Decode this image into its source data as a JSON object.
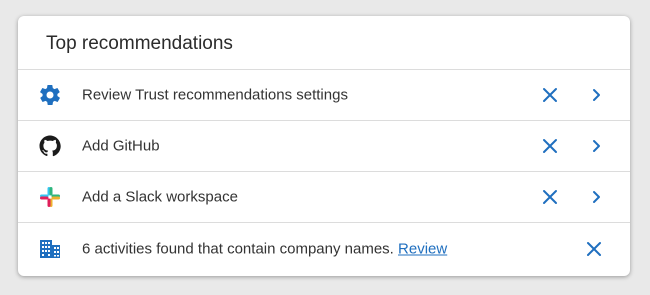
{
  "card": {
    "title": "Top recommendations"
  },
  "rows": [
    {
      "icon": "gear-icon",
      "label": "Review Trust recommendations settings",
      "actions": [
        "dismiss",
        "open"
      ]
    },
    {
      "icon": "github-icon",
      "label": "Add GitHub",
      "actions": [
        "dismiss",
        "open"
      ]
    },
    {
      "icon": "slack-icon",
      "label": "Add a Slack workspace",
      "actions": [
        "dismiss",
        "open"
      ]
    },
    {
      "icon": "building-icon",
      "label": "6 activities found that contain company names.",
      "link": "Review",
      "actions": [
        "dismiss"
      ]
    }
  ],
  "colors": {
    "accent": "#1f6fbf",
    "text": "#333333",
    "divider": "#dcdcdc",
    "slack_red": "#e01e5a",
    "slack_green": "#2eb67d",
    "slack_blue": "#36c5f0",
    "slack_yellow": "#ecb22e"
  }
}
